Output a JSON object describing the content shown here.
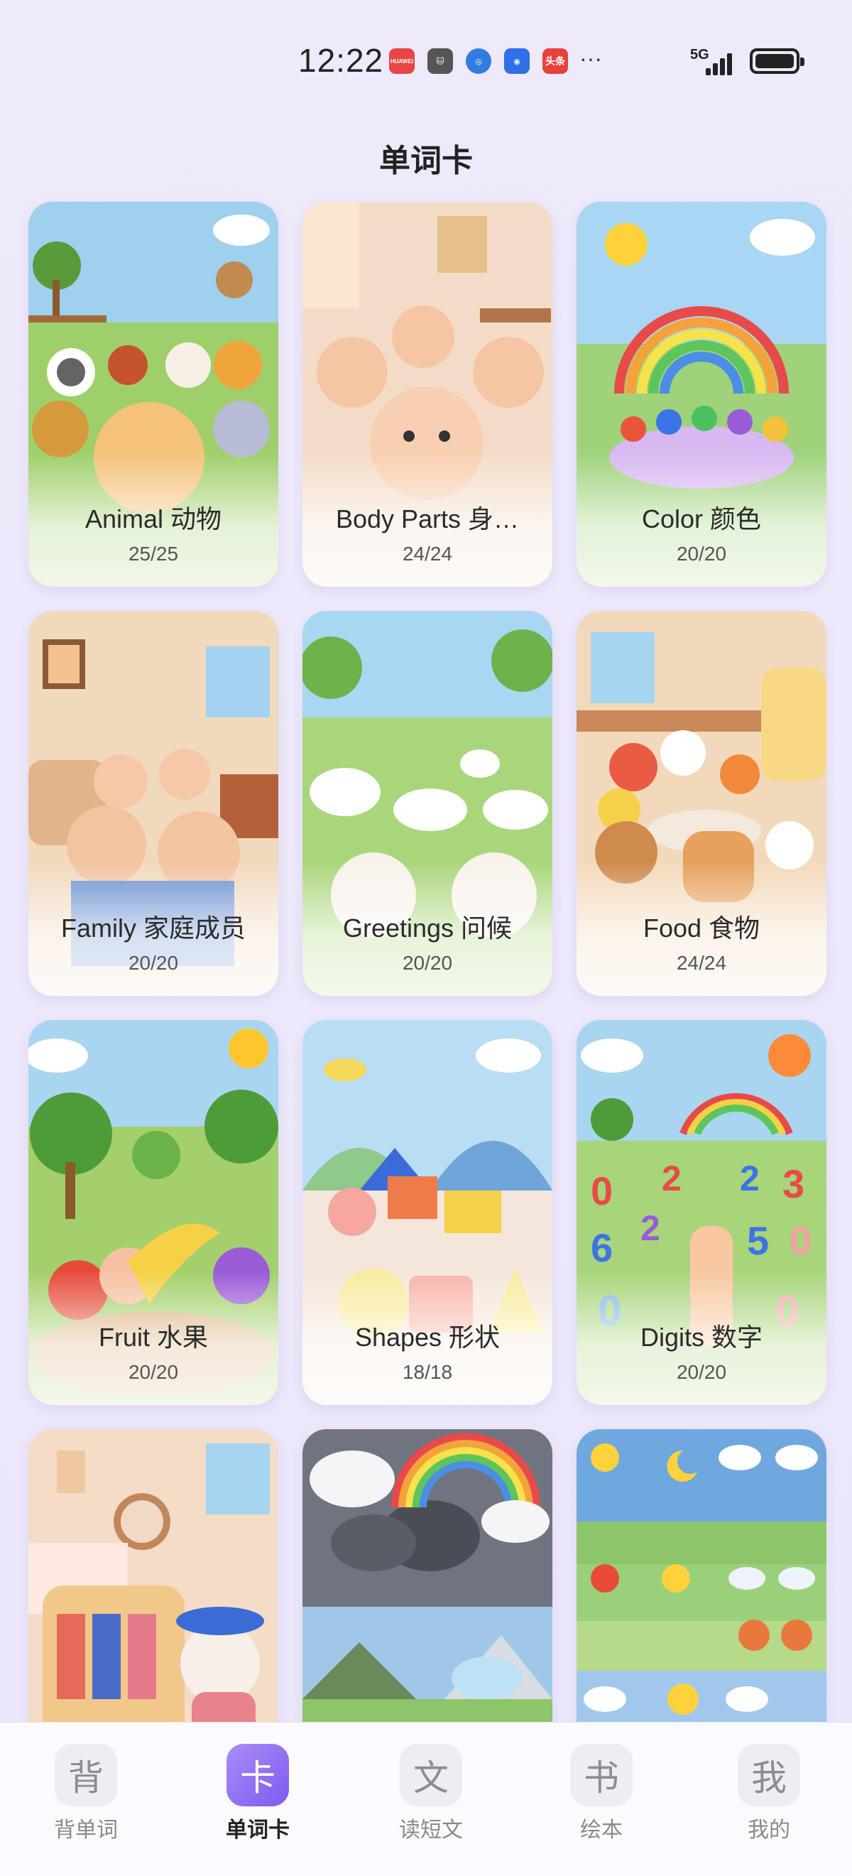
{
  "status": {
    "time": "12:22",
    "network": "5G",
    "notif_labels": [
      "HUAWEI",
      "",
      "",
      "",
      "头条"
    ],
    "overflow": "···"
  },
  "header": {
    "title": "单词卡"
  },
  "cards": [
    {
      "name": "Animal 动物",
      "count": "25/25"
    },
    {
      "name": "Body Parts 身…",
      "count": "24/24"
    },
    {
      "name": "Color 颜色",
      "count": "20/20"
    },
    {
      "name": "Family 家庭成员",
      "count": "20/20"
    },
    {
      "name": "Greetings 问候",
      "count": "20/20"
    },
    {
      "name": "Food 食物",
      "count": "24/24"
    },
    {
      "name": "Fruit 水果",
      "count": "20/20"
    },
    {
      "name": "Shapes 形状",
      "count": "18/18"
    },
    {
      "name": "Digits 数字",
      "count": "20/20"
    },
    {
      "name": "",
      "count": ""
    },
    {
      "name": "",
      "count": ""
    },
    {
      "name": "",
      "count": ""
    }
  ],
  "tabs": [
    {
      "icon": "背",
      "label": "背单词",
      "active": false
    },
    {
      "icon": "卡",
      "label": "单词卡",
      "active": true
    },
    {
      "icon": "文",
      "label": "读短文",
      "active": false
    },
    {
      "icon": "书",
      "label": "绘本",
      "active": false
    },
    {
      "icon": "我",
      "label": "我的",
      "active": false
    }
  ],
  "colors": {
    "accent": "#7d5cf0",
    "background": "#eee9fb"
  }
}
